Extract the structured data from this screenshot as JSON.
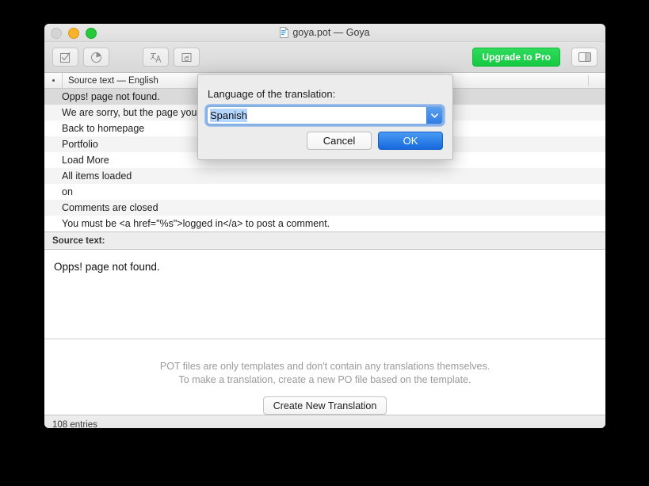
{
  "window": {
    "title": "goya.pot — Goya",
    "doc_icon": "po-document-icon",
    "traffic_lights": [
      "close",
      "minimize",
      "zoom"
    ]
  },
  "toolbar": {
    "buttons": [
      {
        "name": "validate-button",
        "icon": "checkbox-check-icon"
      },
      {
        "name": "statistics-button",
        "icon": "pie-chart-icon"
      },
      {
        "name": "translate-button",
        "icon": "translate-icon"
      },
      {
        "name": "sync-button",
        "icon": "sync-cloud-icon"
      }
    ],
    "upgrade_label": "Upgrade to Pro",
    "upgrade_color": "#14c940",
    "sidebar_toggle_icon": "sidebar-panel-icon"
  },
  "list": {
    "header_dot": "•",
    "header_label": "Source text — English",
    "rows": [
      {
        "text": "Opps! page not found.",
        "state": "selected"
      },
      {
        "text": "We are sorry, but the page you requested was not found.",
        "state": "alt"
      },
      {
        "text": "Back to homepage",
        "state": "plain"
      },
      {
        "text": "Portfolio",
        "state": "alt"
      },
      {
        "text": "Load More",
        "state": "plain"
      },
      {
        "text": "All items loaded",
        "state": "alt"
      },
      {
        "text": "on",
        "state": "plain"
      },
      {
        "text": "Comments are closed",
        "state": "alt"
      },
      {
        "text": "You must be <a href=\"%s\">logged in</a> to post a comment.",
        "state": "plain"
      }
    ]
  },
  "source_panel": {
    "header": "Source text:",
    "body": "Opps! page not found."
  },
  "info_panel": {
    "line1": "POT files are only templates and don't contain any translations themselves.",
    "line2": "To make a translation, create a new PO file based on the template.",
    "button_label": "Create New Translation"
  },
  "status_bar": {
    "entries": "108 entries"
  },
  "dialog": {
    "label": "Language of the translation:",
    "combo_value": "Spanish",
    "combo_arrow_icon": "chevron-down-icon",
    "cancel_label": "Cancel",
    "ok_label": "OK",
    "accent_color": "#1668de"
  }
}
